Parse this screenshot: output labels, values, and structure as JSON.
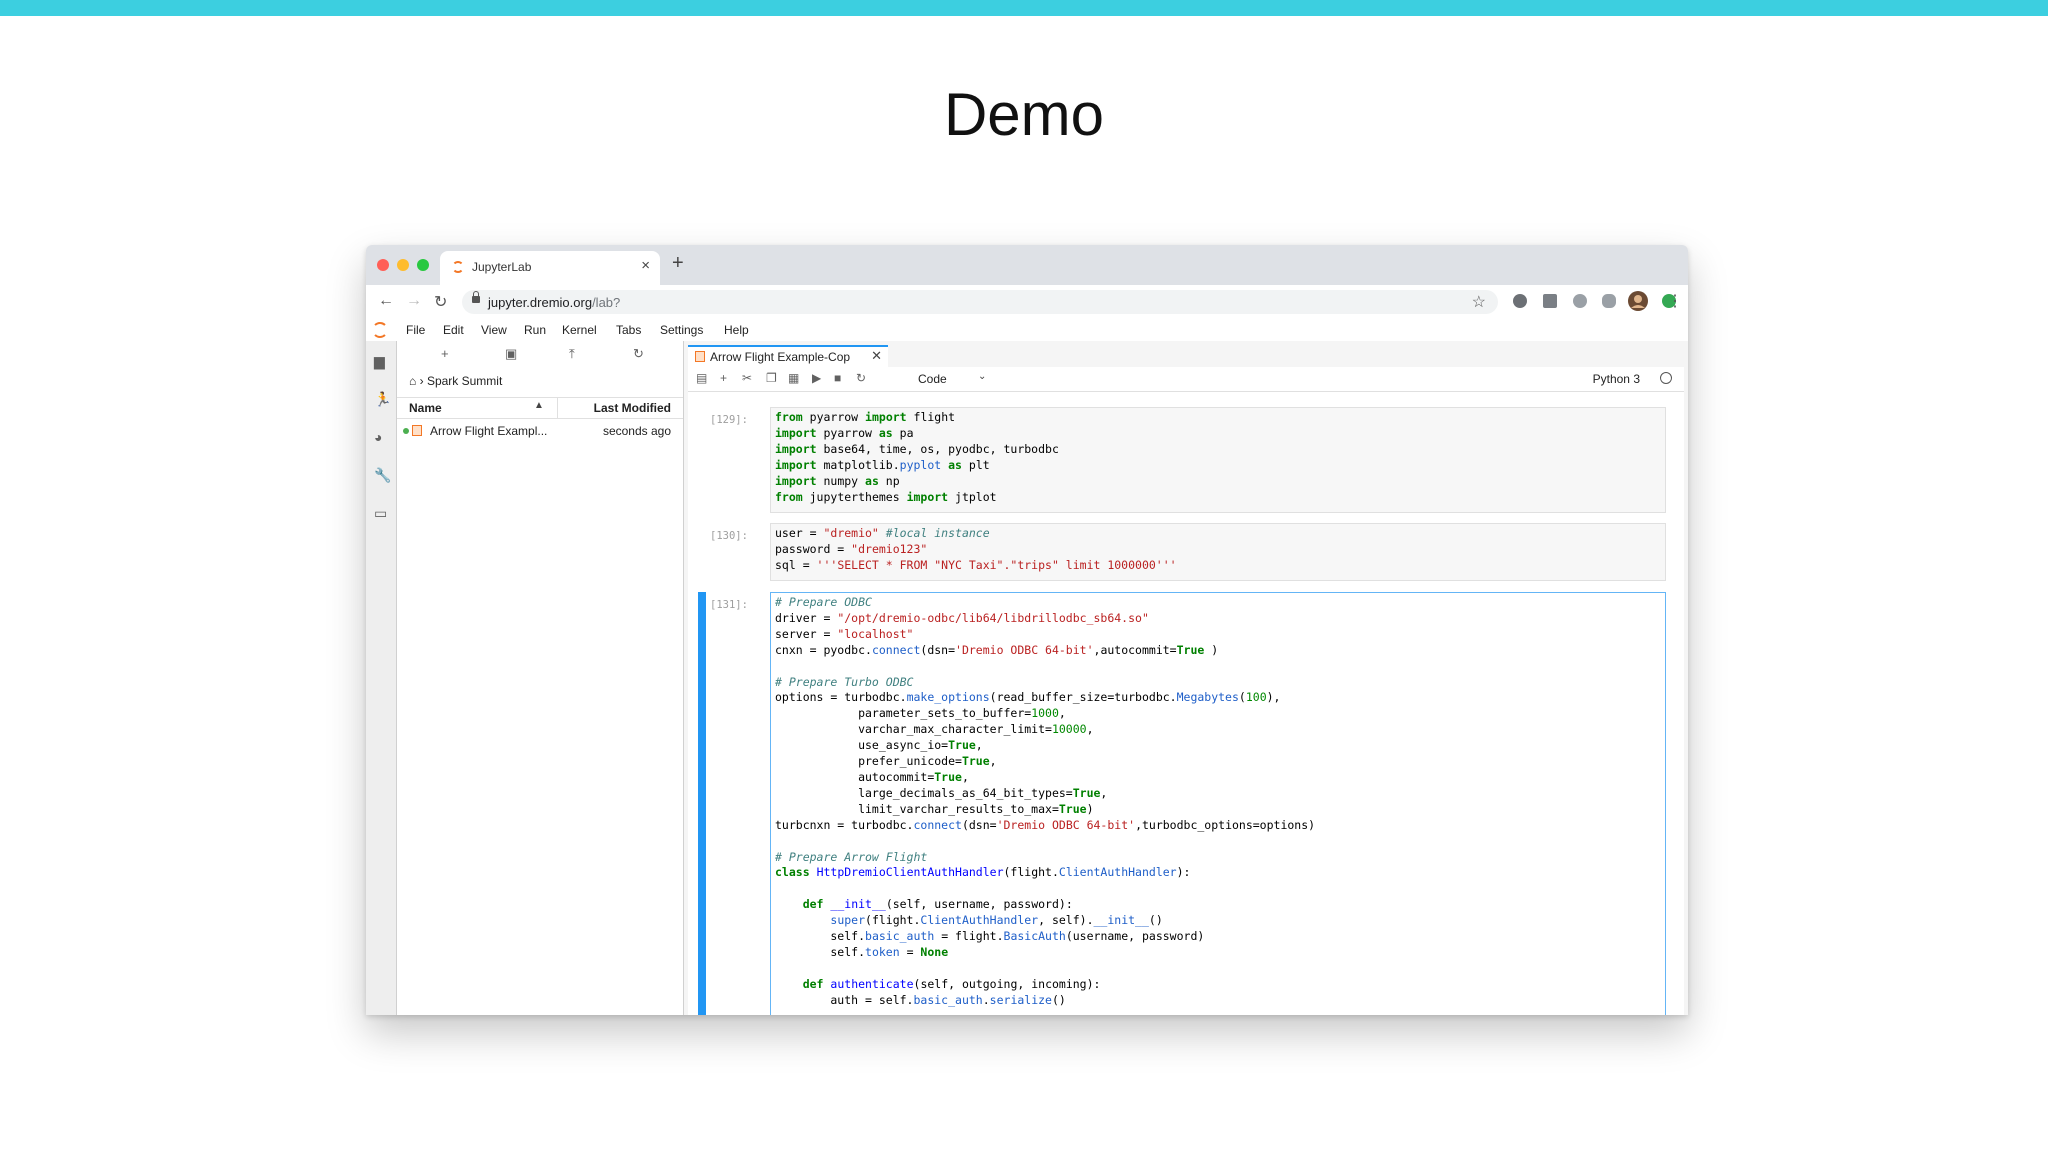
{
  "slide": {
    "title": "Demo"
  },
  "browser": {
    "tab_title": "JupyterLab",
    "tab_close": "×",
    "new_tab": "+",
    "url_host": "jupyter.dremio.org",
    "url_path": "/lab?"
  },
  "menu": [
    "File",
    "Edit",
    "View",
    "Run",
    "Kernel",
    "Tabs",
    "Settings",
    "Help"
  ],
  "file_browser": {
    "breadcrumb": "Spark Summit",
    "col_name": "Name",
    "col_modified": "Last Modified",
    "files": [
      {
        "name": "Arrow Flight Exampl...",
        "modified": "seconds ago"
      }
    ]
  },
  "notebook": {
    "tab_title": "Arrow Flight Example-Cop",
    "cell_type": "Code",
    "kernel": "Python 3",
    "cells": [
      {
        "prompt": "[129]:",
        "lines": [
          "from pyarrow import flight",
          "import pyarrow as pa",
          "import base64, time, os, pyodbc, turbodbc",
          "import matplotlib.pyplot as plt",
          "import numpy as np",
          "from jupyterthemes import jtplot"
        ]
      },
      {
        "prompt": "[130]:",
        "lines": [
          "user = \"dremio\" #local instance",
          "password = \"dremio123\"",
          "sql = '''SELECT * FROM \"NYC Taxi\".\"trips\" limit 1000000'''"
        ]
      },
      {
        "prompt": "[131]:",
        "lines": [
          "# Prepare ODBC",
          "driver = \"/opt/dremio-odbc/lib64/libdrillodbc_sb64.so\"",
          "server = \"localhost\"",
          "cnxn = pyodbc.connect(dsn='Dremio ODBC 64-bit',autocommit=True )",
          "",
          "# Prepare Turbo ODBC",
          "options = turbodbc.make_options(read_buffer_size=turbodbc.Megabytes(100),",
          "            parameter_sets_to_buffer=1000,",
          "            varchar_max_character_limit=10000,",
          "            use_async_io=True,",
          "            prefer_unicode=True,",
          "            autocommit=True,",
          "            large_decimals_as_64_bit_types=True,",
          "            limit_varchar_results_to_max=True)",
          "turbcnxn = turbodbc.connect(dsn='Dremio ODBC 64-bit',turbodbc_options=options)",
          "",
          "# Prepare Arrow Flight",
          "class HttpDremioClientAuthHandler(flight.ClientAuthHandler):",
          "",
          "    def __init__(self, username, password):",
          "        super(flight.ClientAuthHandler, self).__init__()",
          "        self.basic_auth = flight.BasicAuth(username, password)",
          "        self.token = None",
          "",
          "    def authenticate(self, outgoing, incoming):",
          "        auth = self.basic_auth.serialize()"
        ]
      }
    ]
  }
}
